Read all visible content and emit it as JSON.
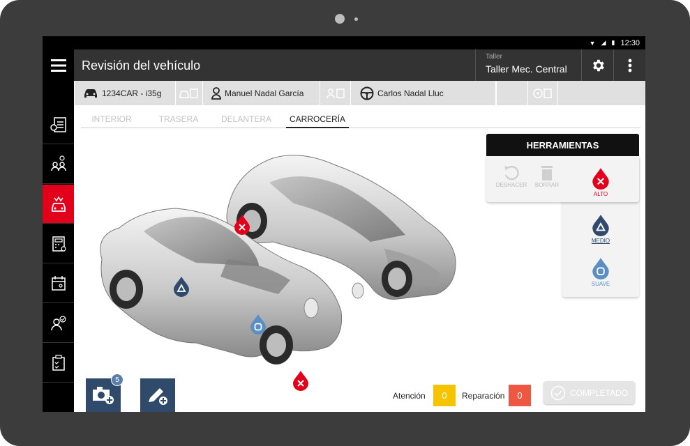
{
  "status_bar": {
    "time": "12:30"
  },
  "app_bar": {
    "title": "Revisión del vehículo",
    "workshop_label": "Taller",
    "workshop_value": "Taller Mec. Central"
  },
  "info_bar": {
    "plate": "1234CAR - i35g",
    "owner": "Manuel Nadal García",
    "driver": "Carlos Nadal Lluc"
  },
  "tabs": [
    {
      "label": "INTERIOR",
      "active": false
    },
    {
      "label": "TRASERA",
      "active": false
    },
    {
      "label": "DELANTERA",
      "active": false
    },
    {
      "label": "CARROCERÍA",
      "active": true
    }
  ],
  "tools": {
    "title": "HERRAMIENTAS",
    "undo": "DESHACER",
    "delete": "BORRAR",
    "high": "ALTO",
    "medium": "MEDIO",
    "soft": "SUAVE"
  },
  "footer": {
    "photo_badge": "5",
    "attention_label": "Atención",
    "attention_value": "0",
    "repair_label": "Reparación",
    "repair_value": "0",
    "complete_label": "COMPLETADO"
  },
  "colors": {
    "accent_red": "#e3001b",
    "navy": "#2f4a6b",
    "medium_blue": "#2f4a6b",
    "soft_blue": "#5b8fc4",
    "attention_yellow": "#f6c300",
    "repair_red": "#ee5741"
  },
  "icons": [
    "menu-icon",
    "gear-icon",
    "more-vert-icon",
    "car-icon",
    "person-icon",
    "steering-wheel-icon",
    "camera-plus-icon",
    "pencil-plus-icon",
    "undo-icon",
    "trash-icon",
    "check-circle-icon"
  ]
}
